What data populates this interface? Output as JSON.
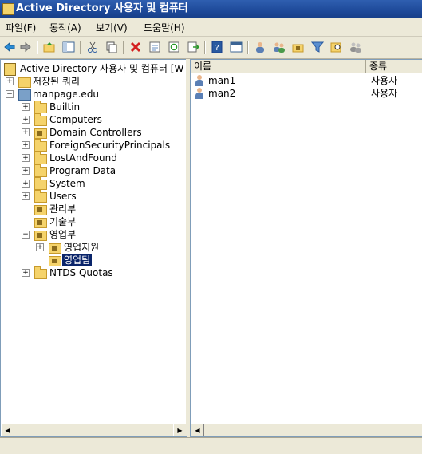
{
  "window": {
    "title": "Active Directory 사용자 및 컴퓨터"
  },
  "menu": [
    "파일(F)",
    "동작(A)",
    "보기(V)",
    "도움말(H)"
  ],
  "toolbar": {
    "icons": [
      "back-icon",
      "forward-icon",
      "up-icon",
      "show-hide-tree-icon",
      "cut-icon",
      "copy-icon",
      "delete-icon",
      "properties-icon",
      "refresh-icon",
      "export-icon",
      "help-icon",
      "mmc-icon",
      "new-user-icon",
      "new-group-icon",
      "new-ou-icon",
      "filter-icon",
      "find-icon",
      "add-to-group-icon"
    ]
  },
  "tree": {
    "root": "Active Directory 사용자 및 컴퓨터 [W",
    "saved_queries": "저장된 쿼리",
    "domain": "manpage.edu",
    "items": {
      "builtin": "Builtin",
      "computers": "Computers",
      "domain_controllers": "Domain Controllers",
      "fsp": "ForeignSecurityPrincipals",
      "lostandfound": "LostAndFound",
      "program_data": "Program Data",
      "system": "System",
      "users": "Users",
      "mgmt": "관리부",
      "tech": "기술부",
      "sales": "영업부",
      "sales_support": "영업지원",
      "sales_team": "영업팀",
      "ntds": "NTDS Quotas"
    }
  },
  "list": {
    "headers": {
      "name": "이름",
      "type": "종류"
    },
    "rows": [
      {
        "name": "man1",
        "type": "사용자"
      },
      {
        "name": "man2",
        "type": "사용자"
      }
    ]
  }
}
